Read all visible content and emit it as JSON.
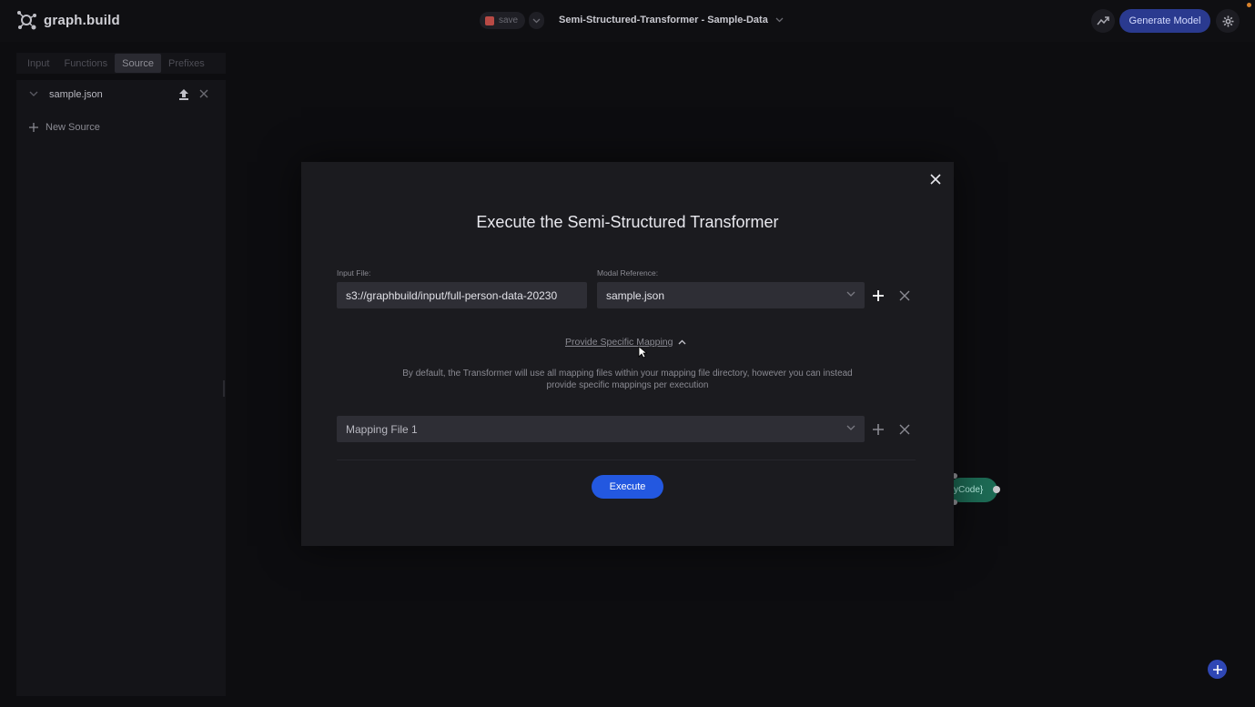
{
  "app": {
    "logo_text": "graph.build"
  },
  "header": {
    "save_label": "save",
    "project_title": "Semi-Structured-Transformer - Sample-Data",
    "generate_label": "Generate Model"
  },
  "sidebar": {
    "tabs": [
      {
        "label": "Input",
        "active": false
      },
      {
        "label": "Functions",
        "active": false
      },
      {
        "label": "Source",
        "active": true
      },
      {
        "label": "Prefixes",
        "active": false
      }
    ],
    "source_file": "sample.json",
    "new_source_label": "New Source"
  },
  "canvas": {
    "node_label": "yCode}"
  },
  "modal": {
    "title": "Execute the Semi-Structured Transformer",
    "input_file_label": "Input File:",
    "input_file_value": "s3://graphbuild/input/full-person-data-20230",
    "modal_reference_label": "Modal Reference:",
    "modal_reference_value": "sample.json",
    "mapping_toggle_label": "Provide Specific Mapping",
    "description": "By default, the Transformer will use all mapping files within your mapping file directory, however you can instead provide specific mappings per execution",
    "mapping_file_value": "Mapping File 1",
    "execute_label": "Execute"
  },
  "colors": {
    "accent": "#2358e0",
    "generate_button": "#2a3a8f",
    "node": "#1d6b55",
    "save_icon": "#b84a45"
  }
}
